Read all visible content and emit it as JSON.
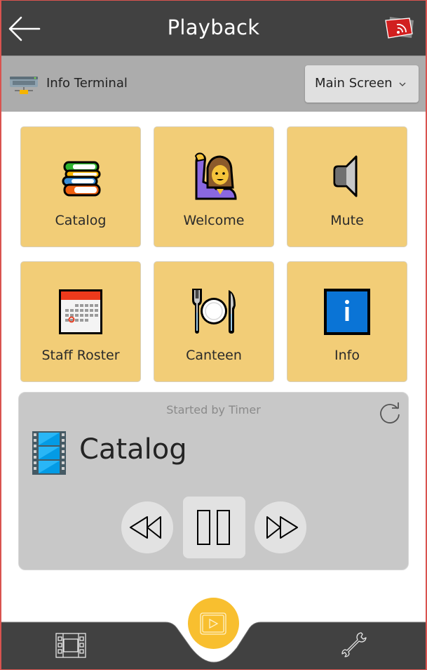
{
  "header": {
    "title": "Playback",
    "back_icon": "arrow-left-icon",
    "cast_icon": "cast-screen-icon"
  },
  "device_bar": {
    "device_icon": "server-network-icon",
    "device_name": "Info Terminal",
    "screen_select": {
      "selected": "Main Screen",
      "icon": "chevron-down-icon"
    }
  },
  "tiles": [
    {
      "label": "Catalog",
      "icon": "books-icon"
    },
    {
      "label": "Welcome",
      "icon": "person-raising-hand-icon"
    },
    {
      "label": "Mute",
      "icon": "speaker-mute-icon"
    },
    {
      "label": "Staff Roster",
      "icon": "calendar-icon"
    },
    {
      "label": "Canteen",
      "icon": "fork-knife-plate-icon"
    },
    {
      "label": "Info",
      "icon": "information-icon"
    }
  ],
  "player": {
    "status": "Started by Timer",
    "now_playing": "Catalog",
    "media_icon": "film-strip-icon",
    "reload_icon": "reload-icon",
    "controls": {
      "rewind_icon": "rewind-icon",
      "pause_icon": "pause-icon",
      "forward_icon": "fast-forward-icon"
    }
  },
  "bottom_nav": {
    "left_icon": "film-icon",
    "center_icon": "play-screen-icon",
    "right_icon": "wrench-icon"
  },
  "colors": {
    "header_bg": "#414141",
    "devicebar_bg": "#acacac",
    "tile_bg": "#f2cd77",
    "player_bg": "#c8c8c8",
    "fab": "#f8bf2f",
    "frame": "#d9534f"
  }
}
